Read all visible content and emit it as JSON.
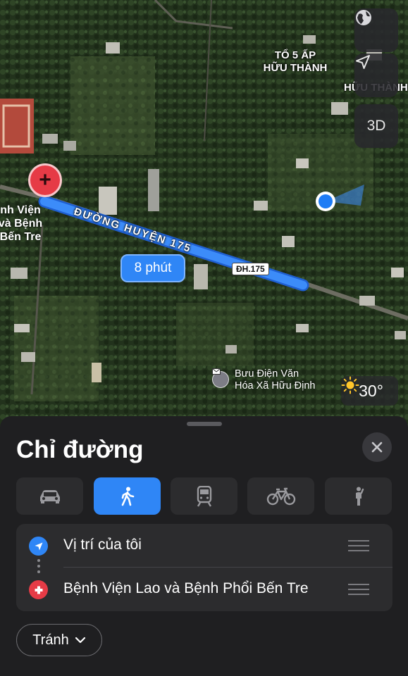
{
  "map": {
    "labels": {
      "hamlet": "TỔ 5 ẤP\nHỮU THÀNH",
      "hamlet_partial": "HỮU THÀNH",
      "road": "ĐƯỜNG HUYỆN 175"
    },
    "route": {
      "duration": "8 phút",
      "road_shield": "ĐH.175",
      "color": "#2f86f6"
    },
    "poi": {
      "name": "Bưu Điện Văn\nHóa Xã Hữu Định",
      "icon": "mail-icon"
    },
    "hospital_label": "nh Viện\nvà Bệnh\nBến Tre",
    "weather": {
      "icon": "sun-icon",
      "temperature": "30°"
    },
    "controls": {
      "globe": "globe-icon",
      "location": "location-arrow-icon",
      "three_d": "3D"
    }
  },
  "sheet": {
    "title": "Chỉ đường",
    "close_icon": "close-icon",
    "modes": [
      {
        "icon": "car-icon",
        "active": false
      },
      {
        "icon": "walk-icon",
        "active": true
      },
      {
        "icon": "train-icon",
        "active": false
      },
      {
        "icon": "bike-icon",
        "active": false
      },
      {
        "icon": "rideshare-icon",
        "active": false
      }
    ],
    "from": {
      "label": "Vị trí của tôi",
      "icon": "location-arrow-icon",
      "color": "#2f86f6"
    },
    "to": {
      "label": "Bệnh Viện Lao và Bệnh Phổi Bến Tre",
      "icon": "hospital-icon",
      "color": "#e63b46"
    },
    "avoid_label": "Tránh"
  }
}
